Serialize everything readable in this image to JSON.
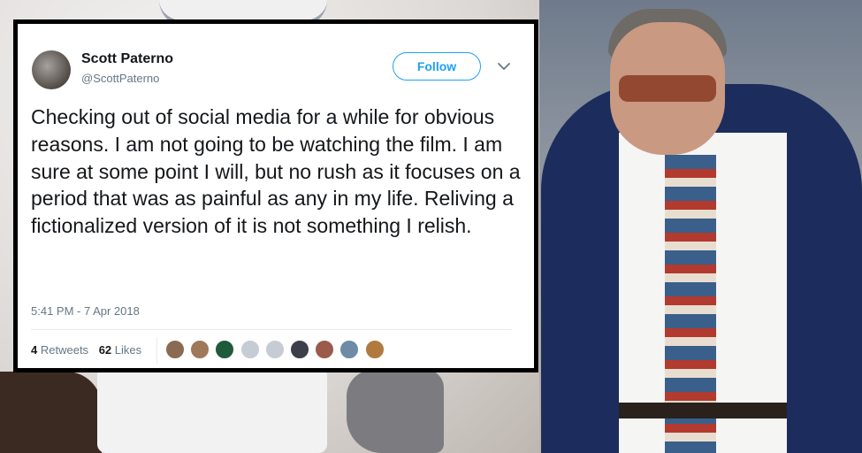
{
  "tweet": {
    "author_name": "Scott Paterno",
    "author_handle": "@ScottPaterno",
    "follow_label": "Follow",
    "text": "Checking out of social media for a while for obvious reasons. I am not going to be watching the film. I am sure at some point I will, but no rush as it focuses on a period that was as painful as any in my life. Reliving a fictionalized version of it is not something I relish.",
    "timestamp": "5:41 PM - 7 Apr 2018",
    "retweets_count": "4",
    "retweets_label": "Retweets",
    "likes_count": "62",
    "likes_label": "Likes",
    "liker_avatar_colors": [
      "#8a6a52",
      "#a0785a",
      "#1f5a3a",
      "#c6ccd3",
      "#c6ccd3",
      "#3c3f4a",
      "#9c5a4a",
      "#6d8aa6",
      "#b07a3e"
    ]
  },
  "colors": {
    "accent": "#1da1f2",
    "text": "#14171a",
    "secondary_text": "#657786",
    "card_border": "#000000"
  }
}
